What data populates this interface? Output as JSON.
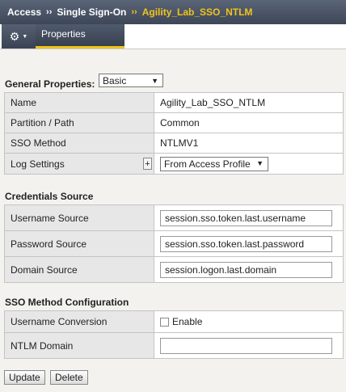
{
  "breadcrumb": {
    "root": "Access",
    "middle": "Single Sign-On",
    "current": "Agility_Lab_SSO_NTLM",
    "separator": "››"
  },
  "tabbar": {
    "gear_icon": "gear-icon",
    "properties_tab": "Properties"
  },
  "general": {
    "heading": "General Properties:",
    "view_select": "Basic",
    "rows": [
      {
        "label": "Name",
        "value": "Agility_Lab_SSO_NTLM"
      },
      {
        "label": "Partition / Path",
        "value": "Common"
      },
      {
        "label": "SSO Method",
        "value": "NTLMV1"
      },
      {
        "label": "Log Settings",
        "value": "From Access Profile",
        "plus": "+"
      }
    ]
  },
  "credentials": {
    "heading": "Credentials Source",
    "rows": [
      {
        "label": "Username Source",
        "value": "session.sso.token.last.username"
      },
      {
        "label": "Password Source",
        "value": "session.sso.token.last.password"
      },
      {
        "label": "Domain Source",
        "value": "session.logon.last.domain"
      }
    ]
  },
  "sso_config": {
    "heading": "SSO Method Configuration",
    "username_conversion": {
      "label": "Username Conversion",
      "checkbox_label": "Enable",
      "checked": false
    },
    "ntlm_domain": {
      "label": "NTLM Domain",
      "value": ""
    }
  },
  "actions": {
    "update": "Update",
    "delete": "Delete"
  },
  "colors": {
    "header_bg": "#4a5466",
    "accent_yellow": "#f0c419",
    "page_bg": "#f3f2ee",
    "label_cell_bg": "#e7e7e7"
  }
}
